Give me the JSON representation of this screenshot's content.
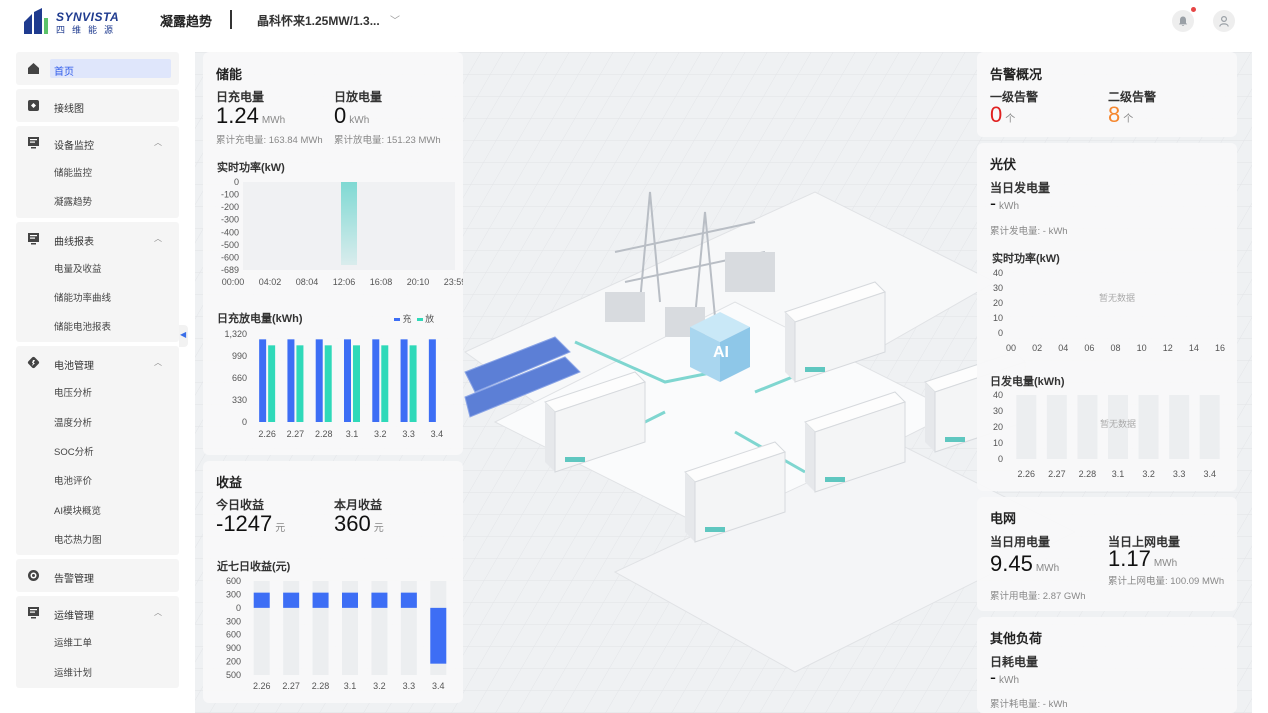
{
  "header": {
    "brand_en": "SYNVISTA",
    "brand_cn": "四维能源",
    "page_title": "凝露趋势",
    "project_selector": "晶科怀来1.25MW/1.3..."
  },
  "sidebar": {
    "items": [
      {
        "label": "首页",
        "icon": "home-icon",
        "active": true
      },
      {
        "label": "接线图",
        "icon": "diagram-icon"
      },
      {
        "label": "设备监控",
        "icon": "monitor-icon",
        "expanded": true,
        "children": [
          "储能监控",
          "凝露趋势"
        ]
      },
      {
        "label": "曲线报表",
        "icon": "report-icon",
        "expanded": true,
        "children": [
          "电量及收益",
          "储能功率曲线",
          "储能电池报表"
        ]
      },
      {
        "label": "电池管理",
        "icon": "battery-icon",
        "expanded": true,
        "children": [
          "电压分析",
          "温度分析",
          "SOC分析",
          "电池评价",
          "AI模块概览",
          "电芯热力图"
        ]
      },
      {
        "label": "告警管理",
        "icon": "alarm-icon"
      },
      {
        "label": "运维管理",
        "icon": "maintenance-icon",
        "expanded": true,
        "children": [
          "运维工单",
          "运维计划"
        ]
      }
    ]
  },
  "storage": {
    "title": "储能",
    "charge_label": "日充电量",
    "charge_value": "1.24",
    "charge_unit": "MWh",
    "discharge_label": "日放电量",
    "discharge_value": "0",
    "discharge_unit": "kWh",
    "cum_charge": "累计充电量: 163.84 MWh",
    "cum_discharge": "累计放电量: 151.23 MWh",
    "power_title": "实时功率(kW)",
    "daily_title": "日充放电量(kWh)",
    "legend_charge": "充",
    "legend_discharge": "放"
  },
  "revenue": {
    "title": "收益",
    "today_label": "今日收益",
    "today_value": "-1247",
    "today_unit": "元",
    "month_label": "本月收益",
    "month_value": "360",
    "month_unit": "元",
    "chart_title": "近七日收益(元)"
  },
  "alarm": {
    "title": "告警概况",
    "l1_label": "一级告警",
    "l1_value": "0",
    "l1_unit": "个",
    "l2_label": "二级告警",
    "l2_value": "8",
    "l2_unit": "个"
  },
  "pv": {
    "title": "光伏",
    "daily_label": "当日发电量",
    "daily_value": "-",
    "daily_unit": "kWh",
    "cum": "累计发电量:  - kWh",
    "power_title": "实时功率(kW)",
    "gen_title": "日发电量(kWh)",
    "no_data": "暂无数据"
  },
  "grid": {
    "title": "电网",
    "use_label": "当日用电量",
    "use_value": "9.45",
    "use_unit": "MWh",
    "feed_label": "当日上网电量",
    "feed_value": "1.17",
    "feed_unit": "MWh",
    "cum_use": "累计用电量: 2.87 GWh",
    "cum_feed": "累计上网电量: 100.09 MWh"
  },
  "other": {
    "title": "其他负荷",
    "daily_label": "日耗电量",
    "daily_value": "-",
    "daily_unit": "kWh",
    "cum": "累计耗电量: - kWh"
  },
  "colors": {
    "charge": "#3d6ef5",
    "discharge": "#2fd9b9",
    "power_area": "#7fd9d3",
    "alarm_l1": "#e02020",
    "alarm_l2": "#f5872f",
    "accent": "#2f5bea"
  },
  "chart_data": [
    {
      "type": "area",
      "title": "实时功率(kW)",
      "x": [
        "00:00",
        "04:02",
        "08:04",
        "12:06",
        "16:08",
        "20:10",
        "23:59"
      ],
      "y_ticks": [
        "0",
        "-100",
        "-200",
        "-300",
        "-400",
        "-500",
        "-600",
        "-689"
      ],
      "ylim": [
        -689,
        0
      ],
      "series": [
        {
          "values": [
            0,
            0,
            0,
            -650,
            0,
            0,
            0
          ]
        }
      ]
    },
    {
      "type": "bar",
      "title": "日充放电量(kWh)",
      "categories": [
        "2.26",
        "2.27",
        "2.28",
        "3.1",
        "3.2",
        "3.3",
        "3.4"
      ],
      "y_ticks": [
        "1,320",
        "990",
        "660",
        "330",
        "0"
      ],
      "ylim": [
        0,
        1320
      ],
      "series": [
        {
          "name": "充",
          "values": [
            1240,
            1240,
            1240,
            1240,
            1240,
            1240,
            1240
          ]
        },
        {
          "name": "放",
          "values": [
            1150,
            1150,
            1150,
            1150,
            1150,
            1150,
            0
          ]
        }
      ]
    },
    {
      "type": "bar",
      "title": "近七日收益(元)",
      "categories": [
        "2.26",
        "2.27",
        "2.28",
        "3.1",
        "3.2",
        "3.3",
        "3.4"
      ],
      "y_ticks": [
        "600",
        "300",
        "0",
        "300",
        "600",
        "900",
        "200",
        "500"
      ],
      "ylim": [
        -1500,
        600
      ],
      "series": [
        {
          "values": [
            340,
            340,
            340,
            340,
            340,
            340,
            -1247
          ]
        }
      ]
    },
    {
      "type": "line",
      "title": "实时功率(kW)",
      "categories": [
        "00",
        "02",
        "04",
        "06",
        "08",
        "10",
        "12",
        "14",
        "16"
      ],
      "y_ticks": [
        "40",
        "30",
        "20",
        "10",
        "0"
      ],
      "ylim": [
        0,
        40
      ],
      "series": []
    },
    {
      "type": "bar",
      "title": "日发电量(kWh)",
      "categories": [
        "2.26",
        "2.27",
        "2.28",
        "3.1",
        "3.2",
        "3.3",
        "3.4"
      ],
      "y_ticks": [
        "40",
        "30",
        "20",
        "10",
        "0"
      ],
      "ylim": [
        0,
        40
      ],
      "series": []
    }
  ]
}
